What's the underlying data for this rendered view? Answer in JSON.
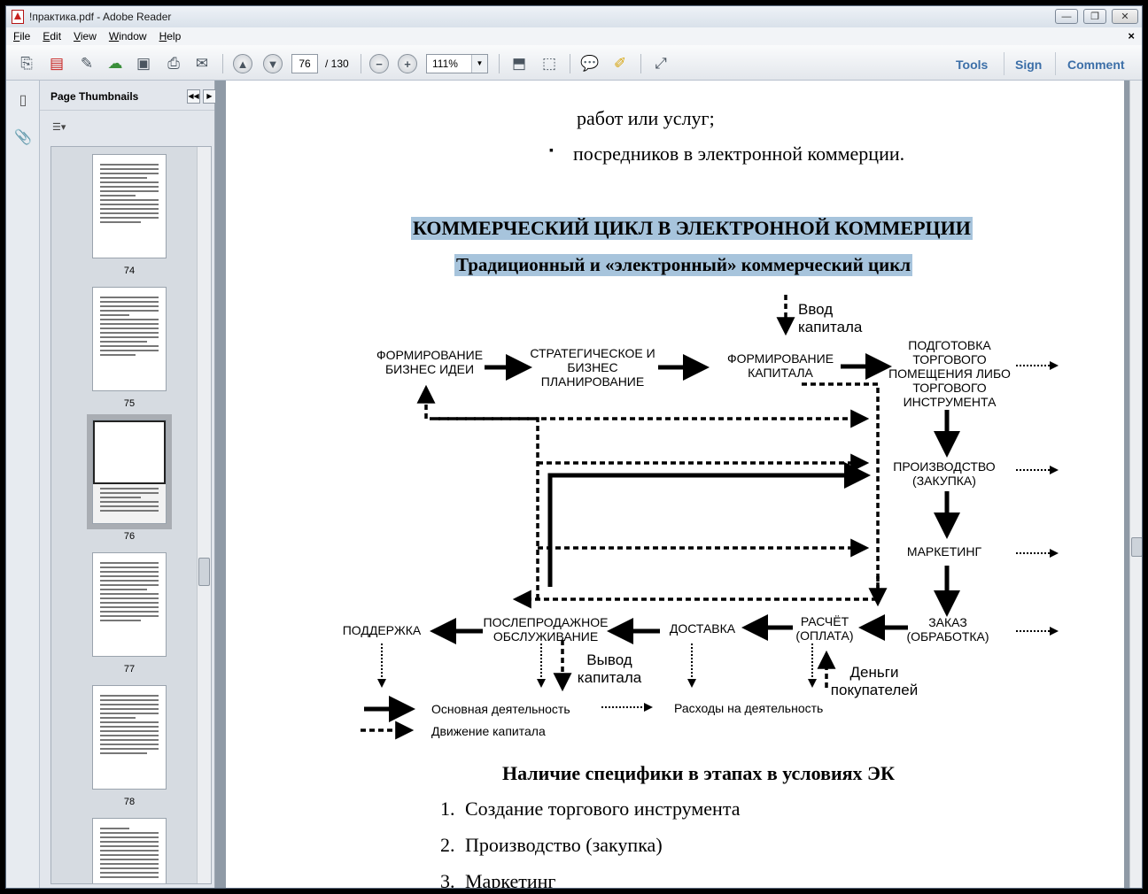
{
  "window": {
    "title": "!практика.pdf - Adobe Reader",
    "controls": {
      "minimize": "—",
      "maximize": "❐",
      "close": "✕"
    }
  },
  "menu": {
    "items": [
      "File",
      "Edit",
      "View",
      "Window",
      "Help"
    ],
    "close_glyph": "×"
  },
  "toolbar": {
    "page_current": "76",
    "page_total": "/ 130",
    "zoom": "111%",
    "right_buttons": [
      "Tools",
      "Sign",
      "Comment"
    ]
  },
  "thumbnails": {
    "title": "Page Thumbnails",
    "pages": [
      "74",
      "75",
      "76",
      "77",
      "78"
    ],
    "selected_page": "76"
  },
  "document": {
    "line1": "работ или услуг;",
    "bullet": "▪",
    "line2": "посредников в электронной коммерции.",
    "heading": "КОММЕРЧЕСКИЙ ЦИКЛ В ЭЛЕКТРОННОЙ КОММЕРЦИИ",
    "subheading": "Традиционный и «электронный» коммерческий цикл",
    "diagram": {
      "capital_in": [
        "Ввод",
        "капитала"
      ],
      "idea": [
        "ФОРМИРОВАНИЕ",
        "БИЗНЕС ИДЕИ"
      ],
      "strategy": [
        "СТРАТЕГИЧЕСКОЕ И",
        "БИЗНЕС",
        "ПЛАНИРОВАНИЕ"
      ],
      "capital": [
        "ФОРМИРОВАНИЕ",
        "КАПИТАЛА"
      ],
      "prep": [
        "ПОДГОТОВКА",
        "ТОРГОВОГО",
        "ПОМЕЩЕНИЯ ЛИБО",
        "ТОРГОВОГО",
        "ИНСТРУМЕНТА"
      ],
      "production": [
        "ПРОИЗВОДСТВО",
        "(ЗАКУПКА)"
      ],
      "marketing": "МАРКЕТИНГ",
      "order": [
        "ЗАКАЗ",
        "(ОБРАБОТКА)"
      ],
      "payment": [
        "РАСЧЁТ",
        "(ОПЛАТА)"
      ],
      "delivery": "ДОСТАВКА",
      "after_sales": [
        "ПОСЛЕПРОДАЖНОЕ",
        "ОБСЛУЖИВАНИЕ"
      ],
      "support": "ПОДДЕРЖКА",
      "capital_out": [
        "Вывод",
        "капитала"
      ],
      "customer_money": [
        "Деньги",
        "покупателей"
      ],
      "legend": {
        "main": "Основная деятельность",
        "expenses": "Расходы на деятельность",
        "capital_flow": "Движение капитала"
      }
    },
    "section_title": "Наличие специфики в этапах в условиях ЭК",
    "list": [
      {
        "num": "1.",
        "text": "Создание торгового инструмента"
      },
      {
        "num": "2.",
        "text": "Производство (закупка)"
      },
      {
        "num": "3.",
        "text": "Маркетинг"
      }
    ]
  }
}
